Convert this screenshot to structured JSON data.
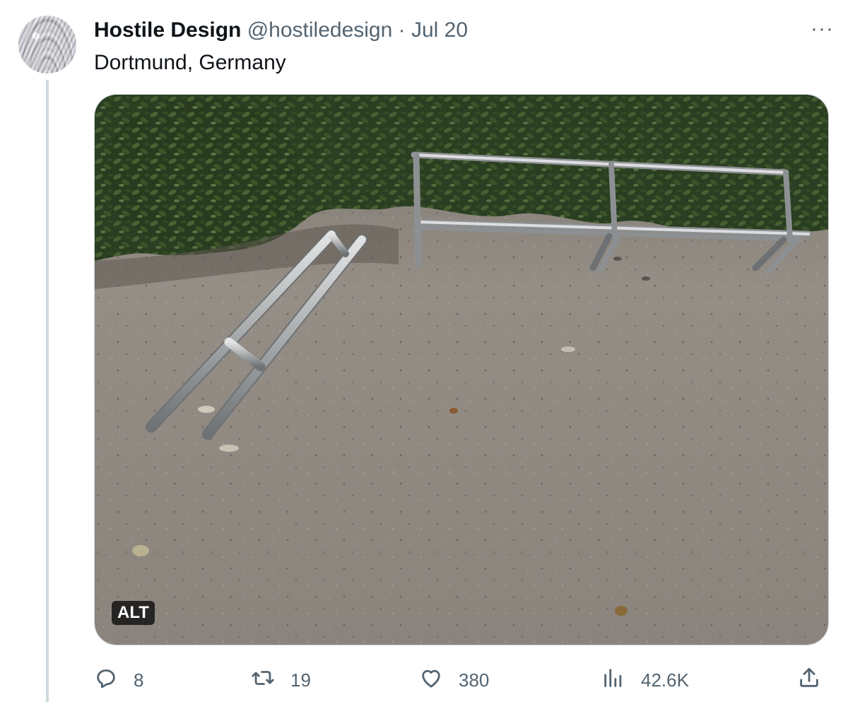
{
  "tweet": {
    "author_name": "Hostile Design",
    "handle": "@hostiledesign",
    "separator": "·",
    "date": "Jul 20",
    "more_label": "···",
    "text": "Dortmund, Germany"
  },
  "media": {
    "alt_badge": "ALT"
  },
  "actions": {
    "reply_count": "8",
    "retweet_count": "19",
    "like_count": "380",
    "views_count": "42.6K"
  },
  "icons": {
    "reply": "speech-bubble-icon",
    "retweet": "retweet-arrows-icon",
    "like": "heart-icon",
    "views": "bar-chart-icon",
    "share": "upload-arrow-icon"
  },
  "colors": {
    "text_primary": "#0f1419",
    "text_secondary": "#536471",
    "thread_line": "#cfd9de"
  }
}
